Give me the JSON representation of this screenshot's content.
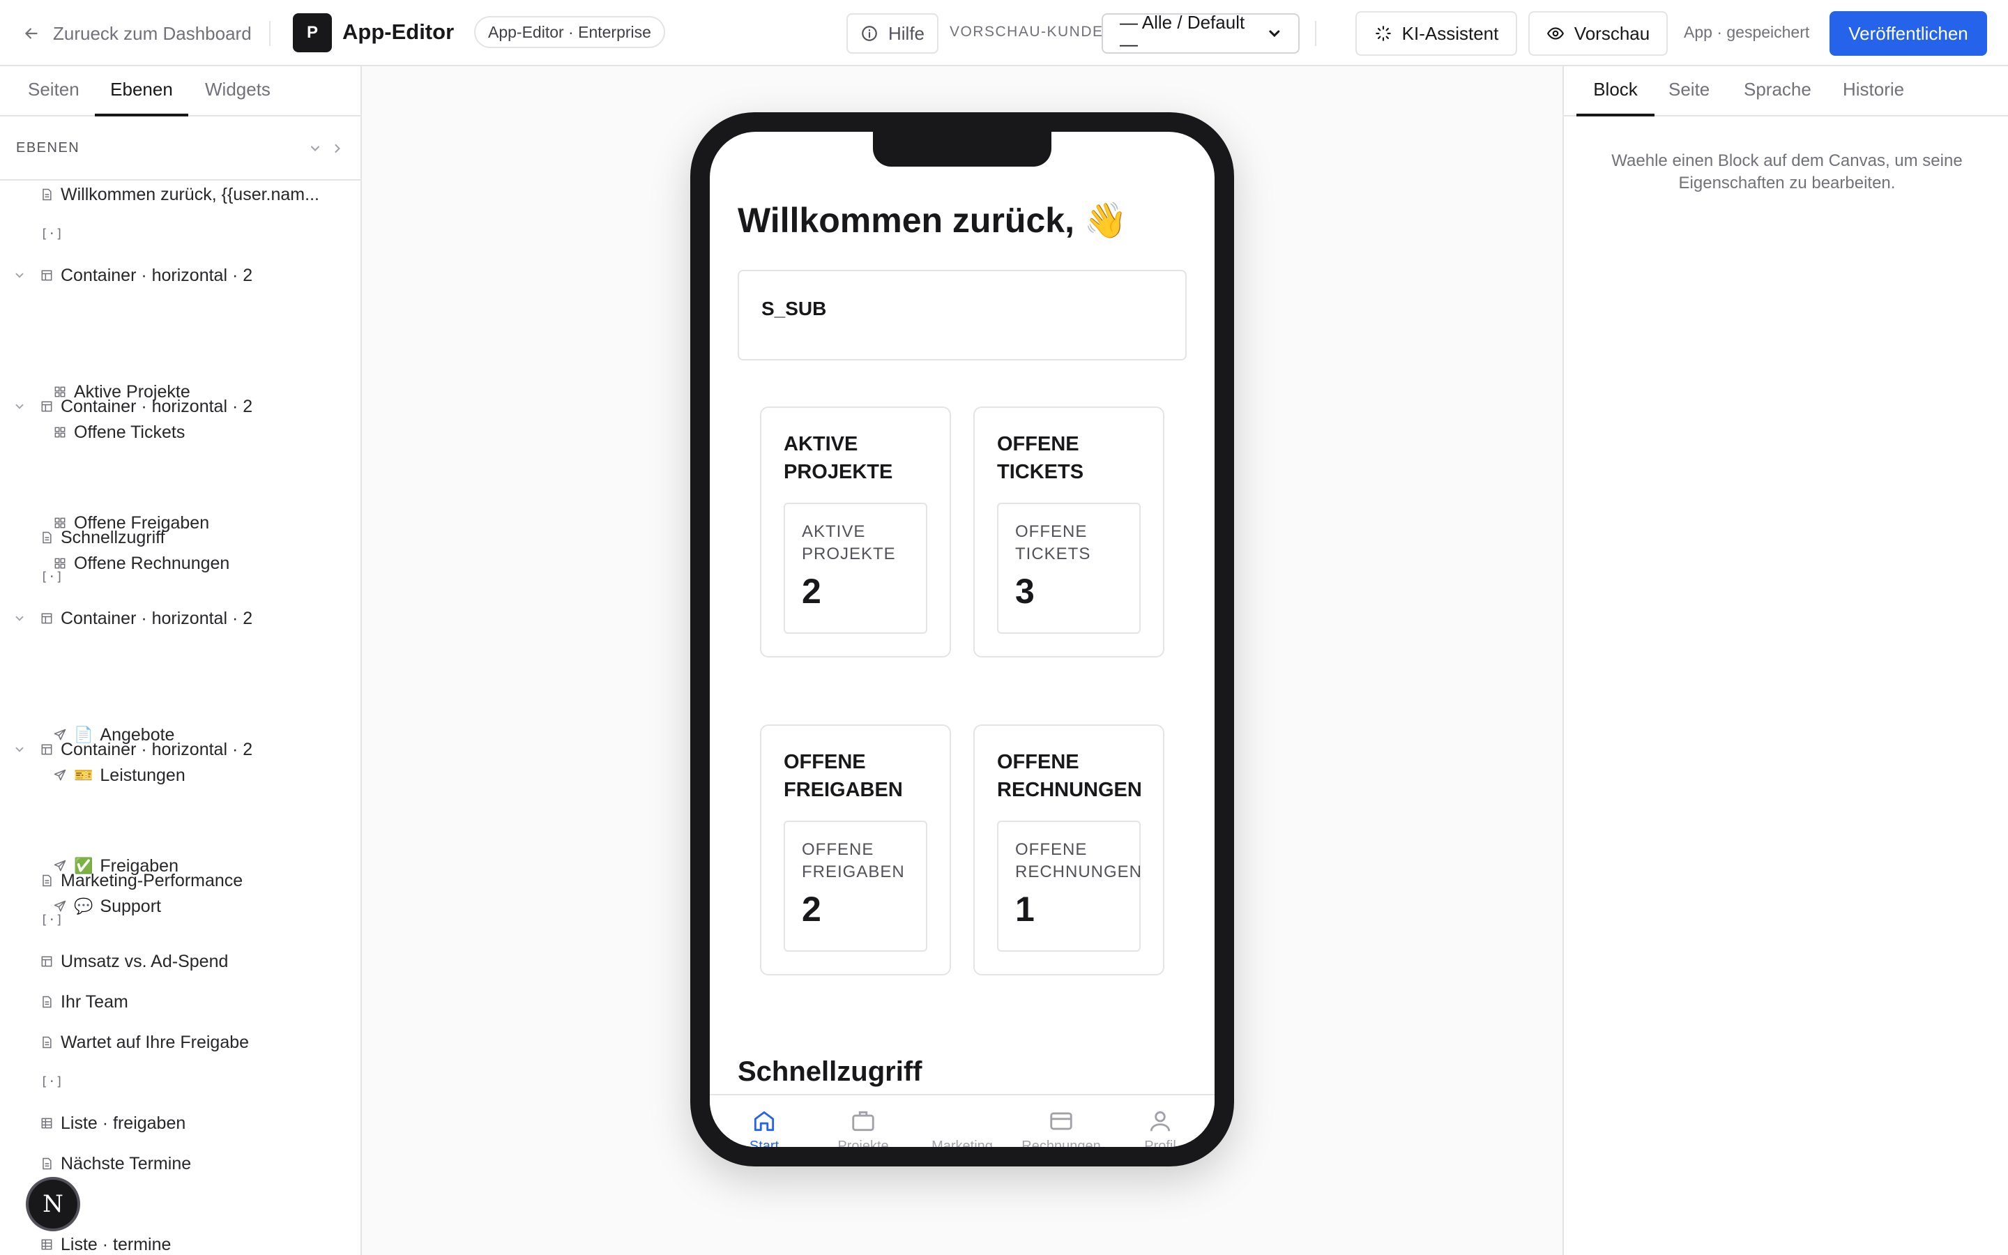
{
  "header": {
    "back_label": "Zurueck zum Dashboard",
    "logo_letter": "P",
    "title": "App-Editor",
    "edition": "App-Editor · Enterprise",
    "help_label": "Hilfe",
    "preview_customer_label": "VORSCHAU-KUNDE",
    "customer_value": "— Alle / Default —",
    "ai_label": "KI-Assistent",
    "preview_label": "Vorschau",
    "saved_status": "App · gespeichert",
    "publish_label": "Veröffentlichen",
    "accent_color": "#2563eb"
  },
  "left_panel": {
    "tabs": [
      "Seiten",
      "Ebenen",
      "Widgets"
    ],
    "active_tab": "Ebenen",
    "layers_title": "EBENEN",
    "separator_glyph": "[·]",
    "layers": [
      {
        "label": "Willkommen zurück, {{user.nam...",
        "icon": "page-icon"
      },
      {
        "label": "Container · horizontal · 2",
        "icon": "layout-icon",
        "expanded": true
      },
      {
        "label": "Aktive Projekte",
        "icon": "grid-icon"
      },
      {
        "label": "Offene Tickets",
        "icon": "grid-icon"
      },
      {
        "label": "Container · horizontal · 2",
        "icon": "layout-icon",
        "expanded": true
      },
      {
        "label": "Offene Freigaben",
        "icon": "grid-icon"
      },
      {
        "label": "Offene Rechnungen",
        "icon": "grid-icon"
      },
      {
        "label": "Schnellzugriff",
        "icon": "page-icon"
      },
      {
        "label": "Container · horizontal · 2",
        "icon": "layout-icon",
        "expanded": true
      },
      {
        "label": "Angebote",
        "icon": "send-icon",
        "emoji": "📄"
      },
      {
        "label": "Leistungen",
        "icon": "send-icon",
        "emoji": "🎫"
      },
      {
        "label": "Container · horizontal · 2",
        "icon": "layout-icon",
        "expanded": true
      },
      {
        "label": "Freigaben",
        "icon": "send-icon",
        "emoji": "✅"
      },
      {
        "label": "Support",
        "icon": "send-icon",
        "emoji": "💬"
      },
      {
        "label": "Marketing-Performance",
        "icon": "page-icon"
      },
      {
        "label": "Umsatz vs. Ad-Spend",
        "icon": "layout-icon"
      },
      {
        "label": "Ihr Team",
        "icon": "page-icon"
      },
      {
        "label": "Wartet auf Ihre Freigabe",
        "icon": "page-icon"
      },
      {
        "label": "Liste · freigaben",
        "icon": "table-icon"
      },
      {
        "label": "Nächste Termine",
        "icon": "page-icon"
      },
      {
        "label": "Liste · termine",
        "icon": "table-icon"
      }
    ],
    "badge_letter": "N"
  },
  "canvas": {
    "welcome": "Willkommen zurück, 👋",
    "sub_text": "S_SUB",
    "kpis": [
      {
        "title": "Aktive Projekte",
        "label": "Aktive Projekte",
        "value": "2"
      },
      {
        "title": "Offene Tickets",
        "label": "Offene Tickets",
        "value": "3"
      },
      {
        "title": "Offene Freigaben",
        "label": "Offene Freigaben",
        "value": "2"
      },
      {
        "title": "Offene Rechnungen",
        "label": "Offene Rechnungen",
        "value": "1"
      }
    ],
    "quick_title": "Schnellzugriff",
    "nav": [
      {
        "label": "Start",
        "icon": "home-icon",
        "active": true
      },
      {
        "label": "Projekte",
        "icon": "briefcase-icon"
      },
      {
        "label": "Marketing",
        "icon": "chart-icon"
      },
      {
        "label": "Rechnungen",
        "icon": "card-icon"
      },
      {
        "label": "Profil",
        "icon": "user-icon"
      }
    ]
  },
  "right_panel": {
    "tabs": [
      "Block",
      "Seite",
      "Sprache",
      "Historie"
    ],
    "active_tab": "Block",
    "hint": "Waehle einen Block auf dem Canvas, um seine Eigenschaften zu bearbeiten."
  }
}
